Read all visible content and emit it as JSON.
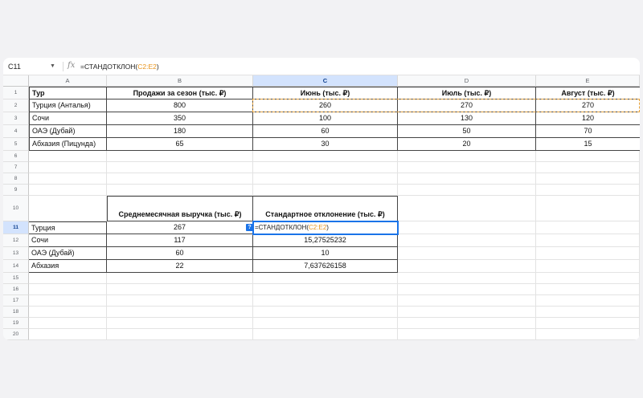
{
  "formula_bar": {
    "cell_ref": "C11",
    "fx_label": "fx",
    "formula_prefix": "=СТАНДОТКЛОН(",
    "formula_range": "C2:E2",
    "formula_suffix": ")"
  },
  "columns": [
    "A",
    "B",
    "C",
    "D",
    "E"
  ],
  "rows": [
    "1",
    "2",
    "3",
    "4",
    "5",
    "6",
    "7",
    "8",
    "9",
    "10",
    "11",
    "12",
    "13",
    "14",
    "15",
    "16",
    "17",
    "18",
    "19",
    "20"
  ],
  "table1": {
    "headers": [
      "Тур",
      "Продажи за сезон (тыс. ₽)",
      "Июнь (тыс. ₽)",
      "Июль (тыс. ₽)",
      "Август (тыс. ₽)"
    ],
    "rows": [
      [
        "Турция (Анталья)",
        "800",
        "260",
        "270",
        "270"
      ],
      [
        "Сочи",
        "350",
        "100",
        "130",
        "120"
      ],
      [
        "ОАЭ (Дубай)",
        "180",
        "60",
        "50",
        "70"
      ],
      [
        "Абхазия (Пицунда)",
        "65",
        "30",
        "20",
        "15"
      ]
    ]
  },
  "table2": {
    "headers": [
      "Среднемесячная выручка (тыс. ₽)",
      "Стандартное отклонение (тыс. ₽)"
    ],
    "rows": [
      [
        "Турция",
        "267",
        ""
      ],
      [
        "Сочи",
        "117",
        "15,27525232"
      ],
      [
        "ОАЭ (Дубай)",
        "60",
        "10"
      ],
      [
        "Абхазия",
        "22",
        "7,637626158"
      ]
    ]
  },
  "active_cell": {
    "prefix": "=СТАНДОТКЛОН(",
    "range": "C2:E2",
    "suffix": ")",
    "badge": "?"
  },
  "colors": {
    "selection_blue": "#1a73e8",
    "range_orange": "#e8a33a",
    "header_selected": "#d3e3fd"
  }
}
